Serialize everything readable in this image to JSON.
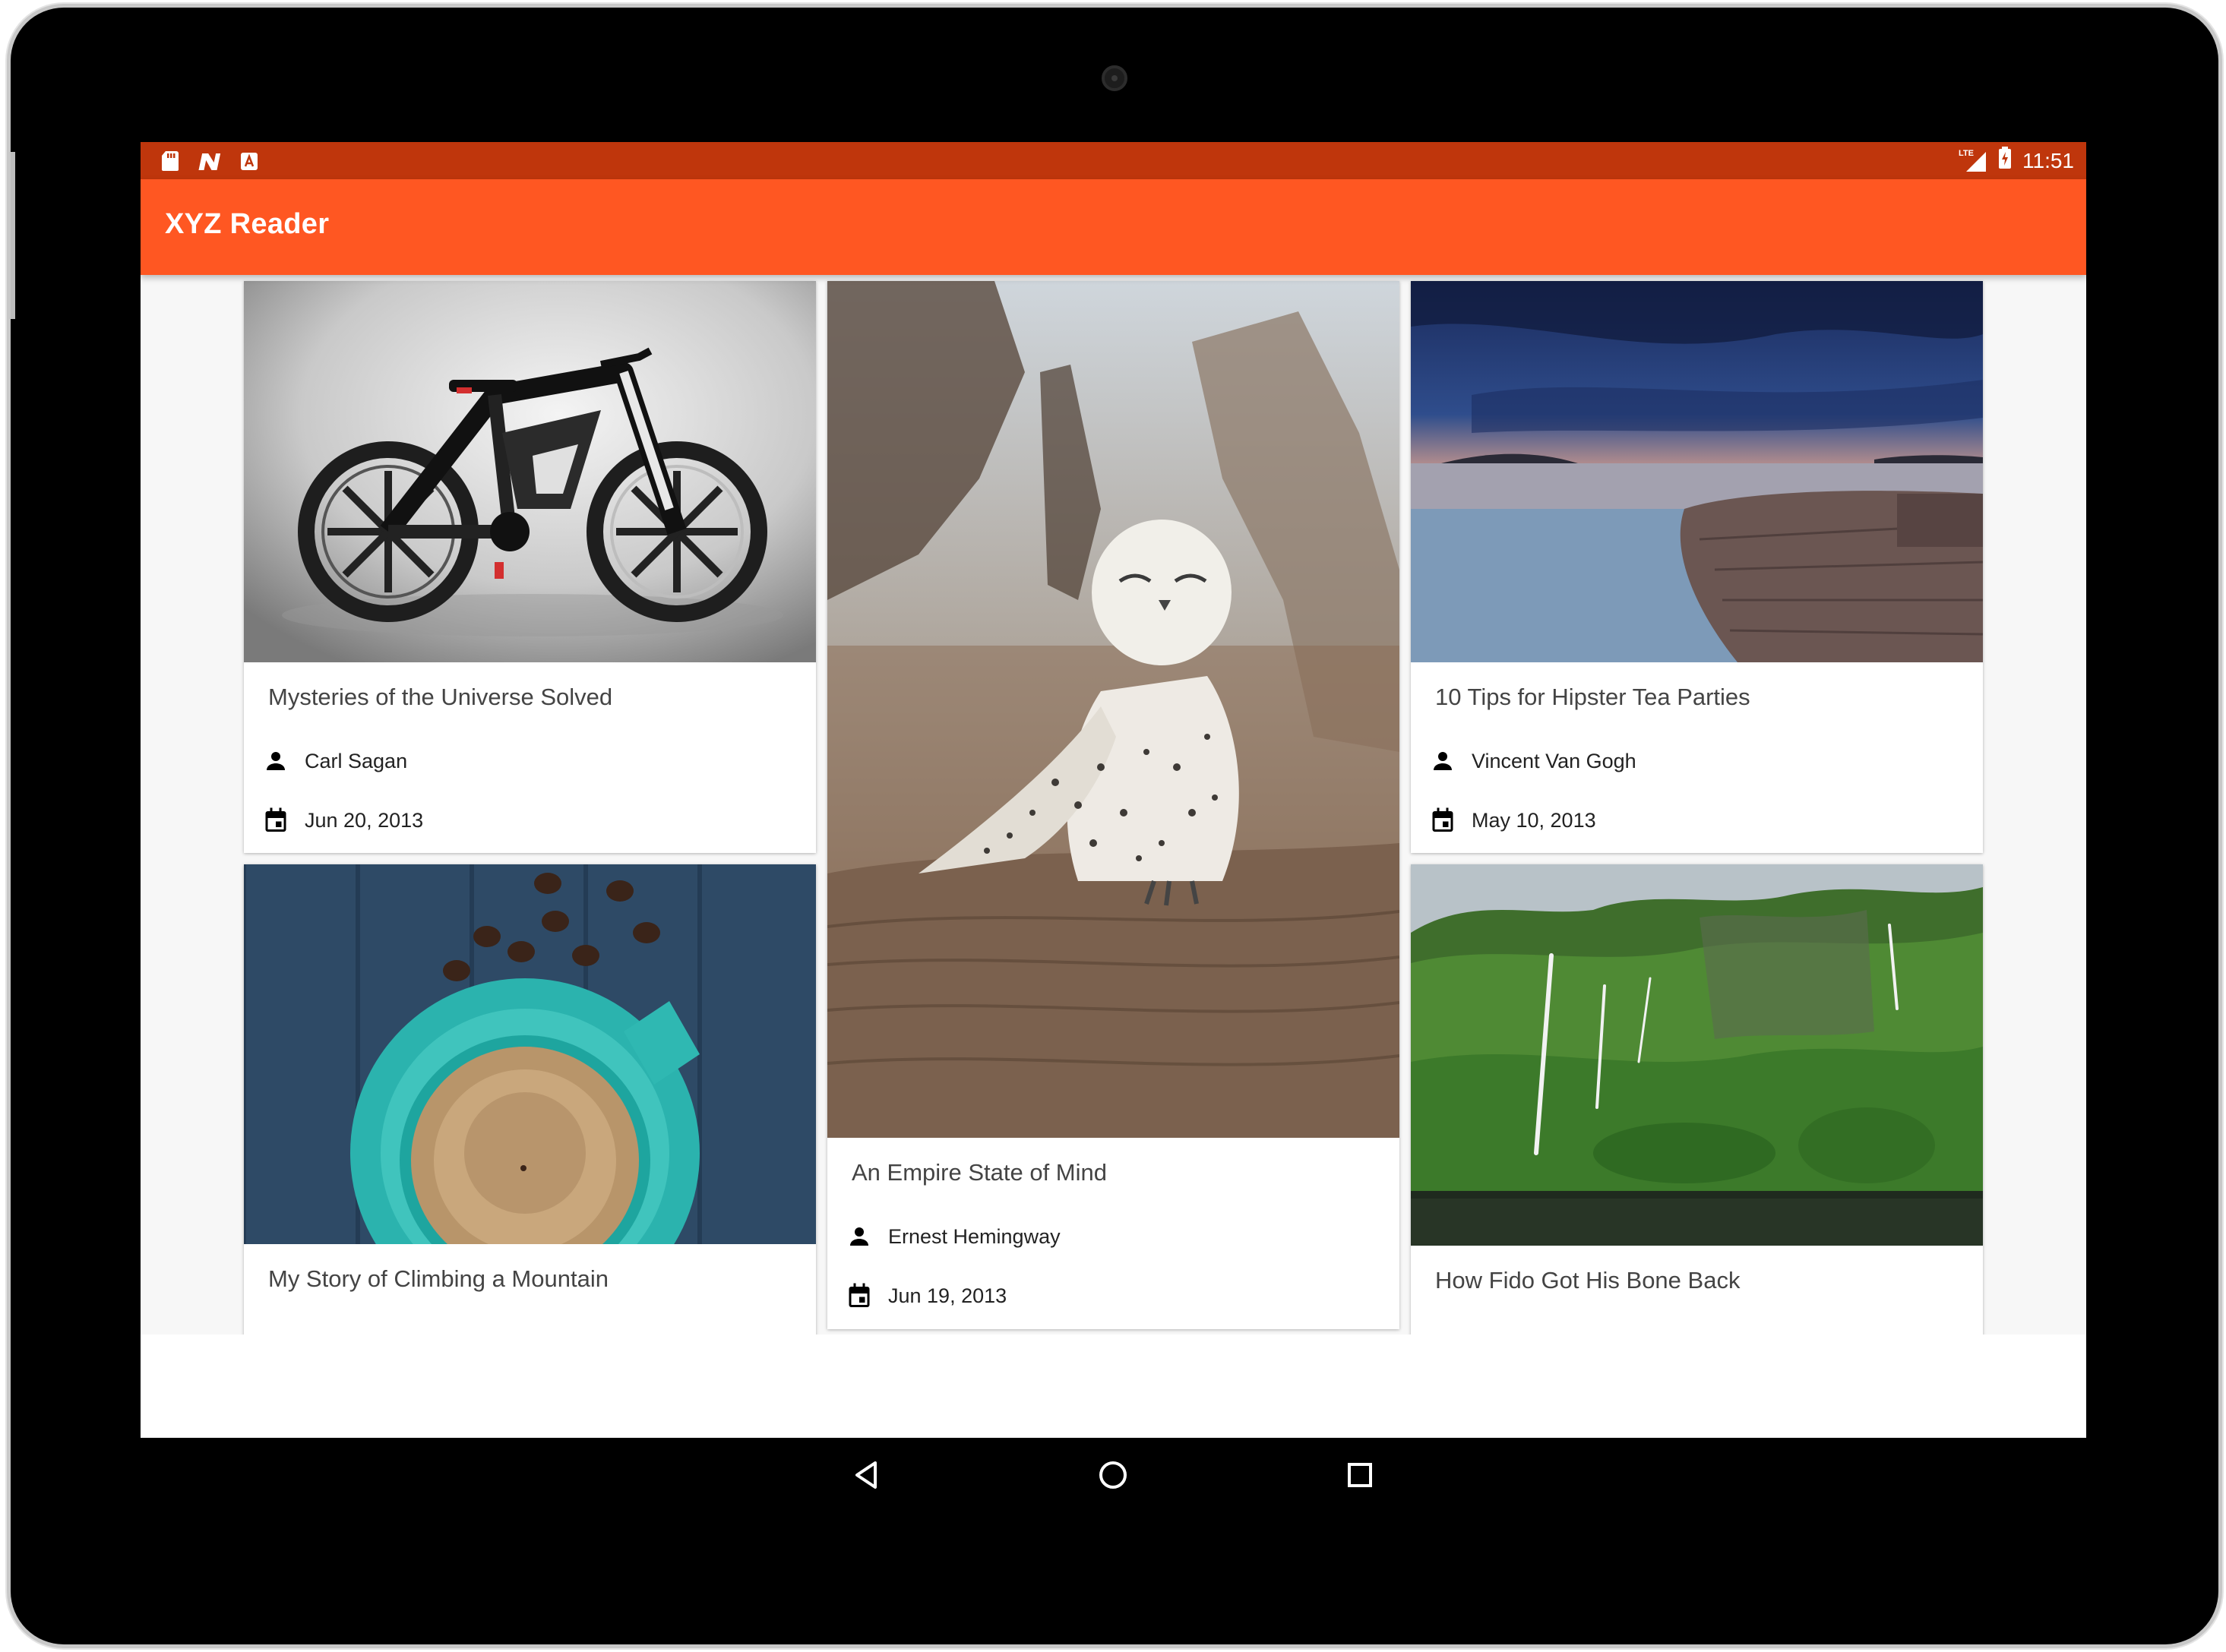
{
  "app": {
    "title": "XYZ Reader",
    "accent_color": "#ff5722",
    "status_color": "#bf360c"
  },
  "status_bar": {
    "left_icons": [
      "sd-card-icon",
      "notification-n-icon",
      "store-icon"
    ],
    "network_label": "LTE",
    "time": "11:51"
  },
  "articles": [
    {
      "title": "Mysteries of the Universe Solved",
      "author": "Carl Sagan",
      "date": "Jun 20, 2013",
      "image": "electric-bicycle-photo"
    },
    {
      "title": "An Empire State of Mind",
      "author": "Ernest Hemingway",
      "date": "Jun 19, 2013",
      "image": "snowy-owl-photo"
    },
    {
      "title": "10 Tips for Hipster Tea Parties",
      "author": "Vincent Van Gogh",
      "date": "May 10, 2013",
      "image": "rocky-coast-sunset-photo"
    },
    {
      "title": "My Story of Climbing a Mountain",
      "image": "coffee-cup-photo"
    },
    {
      "title": "How Fido Got His Bone Back",
      "image": "green-cliffs-waterfalls-photo"
    }
  ],
  "nav_bar": {
    "buttons": [
      "back-icon",
      "home-icon",
      "recents-icon"
    ]
  }
}
